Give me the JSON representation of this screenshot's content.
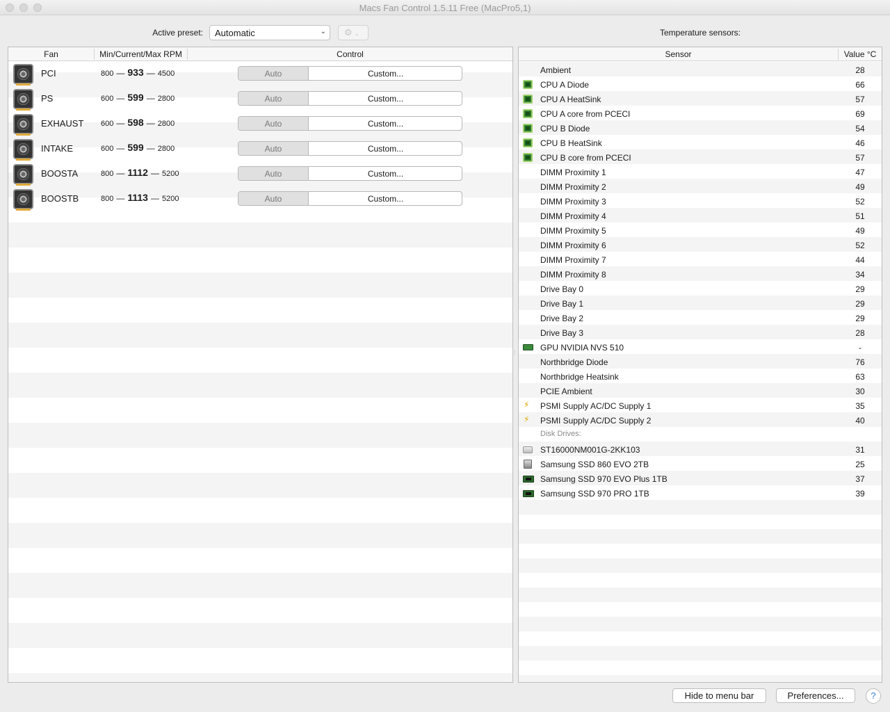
{
  "window": {
    "title": "Macs Fan Control 1.5.11 Free (MacPro5,1)"
  },
  "preset": {
    "label": "Active preset:",
    "selected": "Automatic"
  },
  "sensors_label": "Temperature sensors:",
  "fan_table": {
    "headers": {
      "fan": "Fan",
      "rpm": "Min/Current/Max RPM",
      "control": "Control"
    },
    "rows": [
      {
        "name": "PCI",
        "min": "800",
        "current": "933",
        "max": "4500",
        "auto": "Auto",
        "custom": "Custom..."
      },
      {
        "name": "PS",
        "min": "600",
        "current": "599",
        "max": "2800",
        "auto": "Auto",
        "custom": "Custom..."
      },
      {
        "name": "EXHAUST",
        "min": "600",
        "current": "598",
        "max": "2800",
        "auto": "Auto",
        "custom": "Custom..."
      },
      {
        "name": "INTAKE",
        "min": "600",
        "current": "599",
        "max": "2800",
        "auto": "Auto",
        "custom": "Custom..."
      },
      {
        "name": "BOOSTA",
        "min": "800",
        "current": "1112",
        "max": "5200",
        "auto": "Auto",
        "custom": "Custom..."
      },
      {
        "name": "BOOSTB",
        "min": "800",
        "current": "1113",
        "max": "5200",
        "auto": "Auto",
        "custom": "Custom..."
      }
    ]
  },
  "sensor_table": {
    "headers": {
      "sensor": "Sensor",
      "value": "Value °C"
    },
    "rows": [
      {
        "name": "Ambient",
        "value": "28",
        "icon": "none"
      },
      {
        "name": "CPU A Diode",
        "value": "66",
        "icon": "cpu-chip-icon"
      },
      {
        "name": "CPU A HeatSink",
        "value": "57",
        "icon": "cpu-chip-icon"
      },
      {
        "name": "CPU A core from PCECI",
        "value": "69",
        "icon": "cpu-chip-icon"
      },
      {
        "name": "CPU B Diode",
        "value": "54",
        "icon": "cpu-chip-icon"
      },
      {
        "name": "CPU B HeatSink",
        "value": "46",
        "icon": "cpu-chip-icon"
      },
      {
        "name": "CPU B core from PCECI",
        "value": "57",
        "icon": "cpu-chip-icon"
      },
      {
        "name": "DIMM Proximity 1",
        "value": "47",
        "icon": "none"
      },
      {
        "name": "DIMM Proximity 2",
        "value": "49",
        "icon": "none"
      },
      {
        "name": "DIMM Proximity 3",
        "value": "52",
        "icon": "none"
      },
      {
        "name": "DIMM Proximity 4",
        "value": "51",
        "icon": "none"
      },
      {
        "name": "DIMM Proximity 5",
        "value": "49",
        "icon": "none"
      },
      {
        "name": "DIMM Proximity 6",
        "value": "52",
        "icon": "none"
      },
      {
        "name": "DIMM Proximity 7",
        "value": "44",
        "icon": "none"
      },
      {
        "name": "DIMM Proximity 8",
        "value": "34",
        "icon": "none"
      },
      {
        "name": "Drive Bay 0",
        "value": "29",
        "icon": "none"
      },
      {
        "name": "Drive Bay 1",
        "value": "29",
        "icon": "none"
      },
      {
        "name": "Drive Bay 2",
        "value": "29",
        "icon": "none"
      },
      {
        "name": "Drive Bay 3",
        "value": "28",
        "icon": "none"
      },
      {
        "name": "GPU NVIDIA NVS 510",
        "value": "-",
        "icon": "gpu-card-icon"
      },
      {
        "name": "Northbridge Diode",
        "value": "76",
        "icon": "none"
      },
      {
        "name": "Northbridge Heatsink",
        "value": "63",
        "icon": "none"
      },
      {
        "name": "PCIE Ambient",
        "value": "30",
        "icon": "none"
      },
      {
        "name": "PSMI Supply AC/DC Supply 1",
        "value": "35",
        "icon": "lightning-bolt-icon"
      },
      {
        "name": "PSMI Supply AC/DC Supply 2",
        "value": "40",
        "icon": "lightning-bolt-icon"
      }
    ],
    "disk_header": "Disk Drives:",
    "disk_rows": [
      {
        "name": "ST16000NM001G-2KK103",
        "value": "31",
        "icon": "hard-drive-icon"
      },
      {
        "name": "Samsung SSD 860 EVO 2TB",
        "value": "25",
        "icon": "ssd-icon"
      },
      {
        "name": "Samsung SSD 970 EVO Plus 1TB",
        "value": "37",
        "icon": "nvme-ssd-icon"
      },
      {
        "name": "Samsung SSD 970 PRO 1TB",
        "value": "39",
        "icon": "nvme-ssd-icon"
      }
    ]
  },
  "buttons": {
    "hide": "Hide to menu bar",
    "preferences": "Preferences...",
    "help": "?"
  }
}
